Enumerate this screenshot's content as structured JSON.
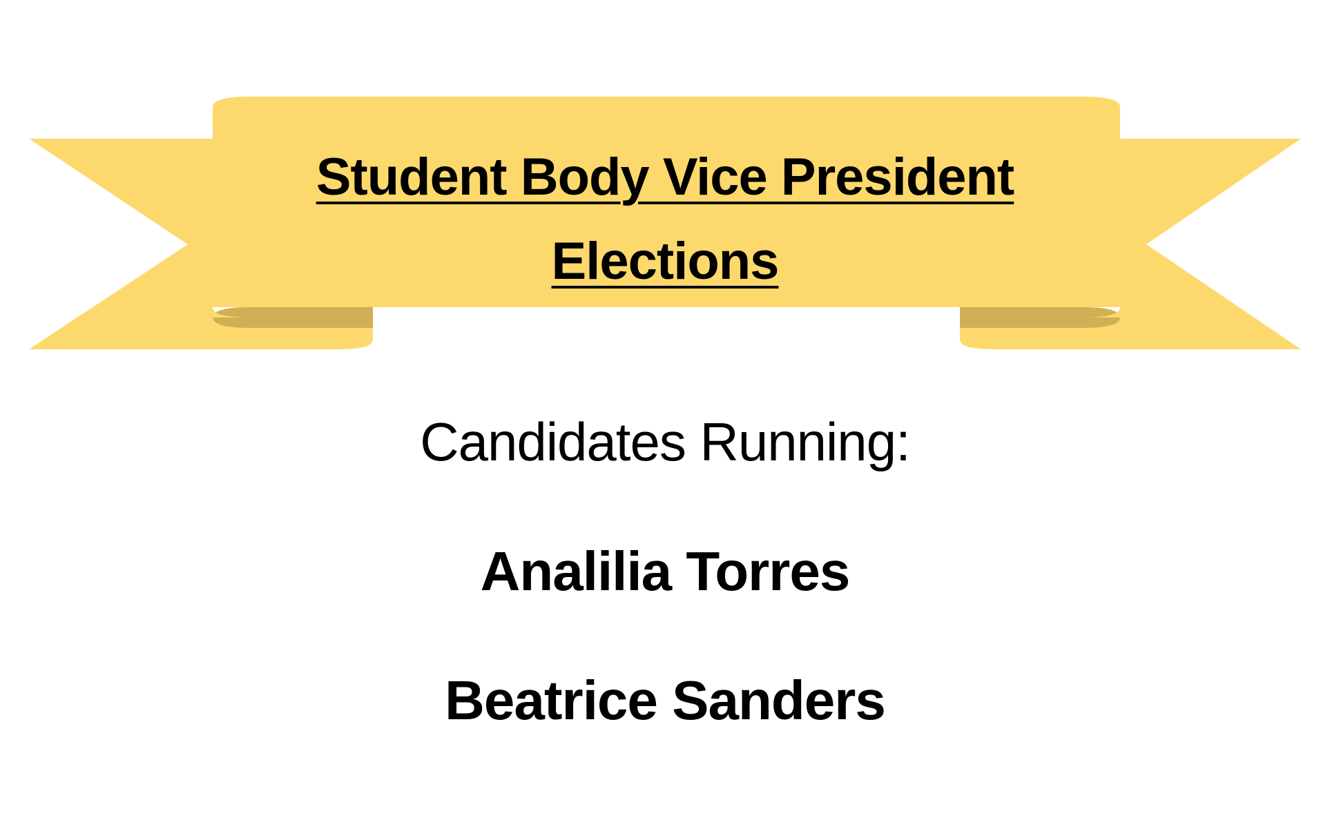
{
  "banner": {
    "title_line1": "Student Body Vice President",
    "title_line2": "Elections",
    "colors": {
      "ribbon": "#FDD96D",
      "ribbon_fold": "#CFB055"
    }
  },
  "content": {
    "subheading": "Candidates Running:",
    "candidates": [
      "Analilia Torres",
      "Beatrice Sanders"
    ]
  }
}
